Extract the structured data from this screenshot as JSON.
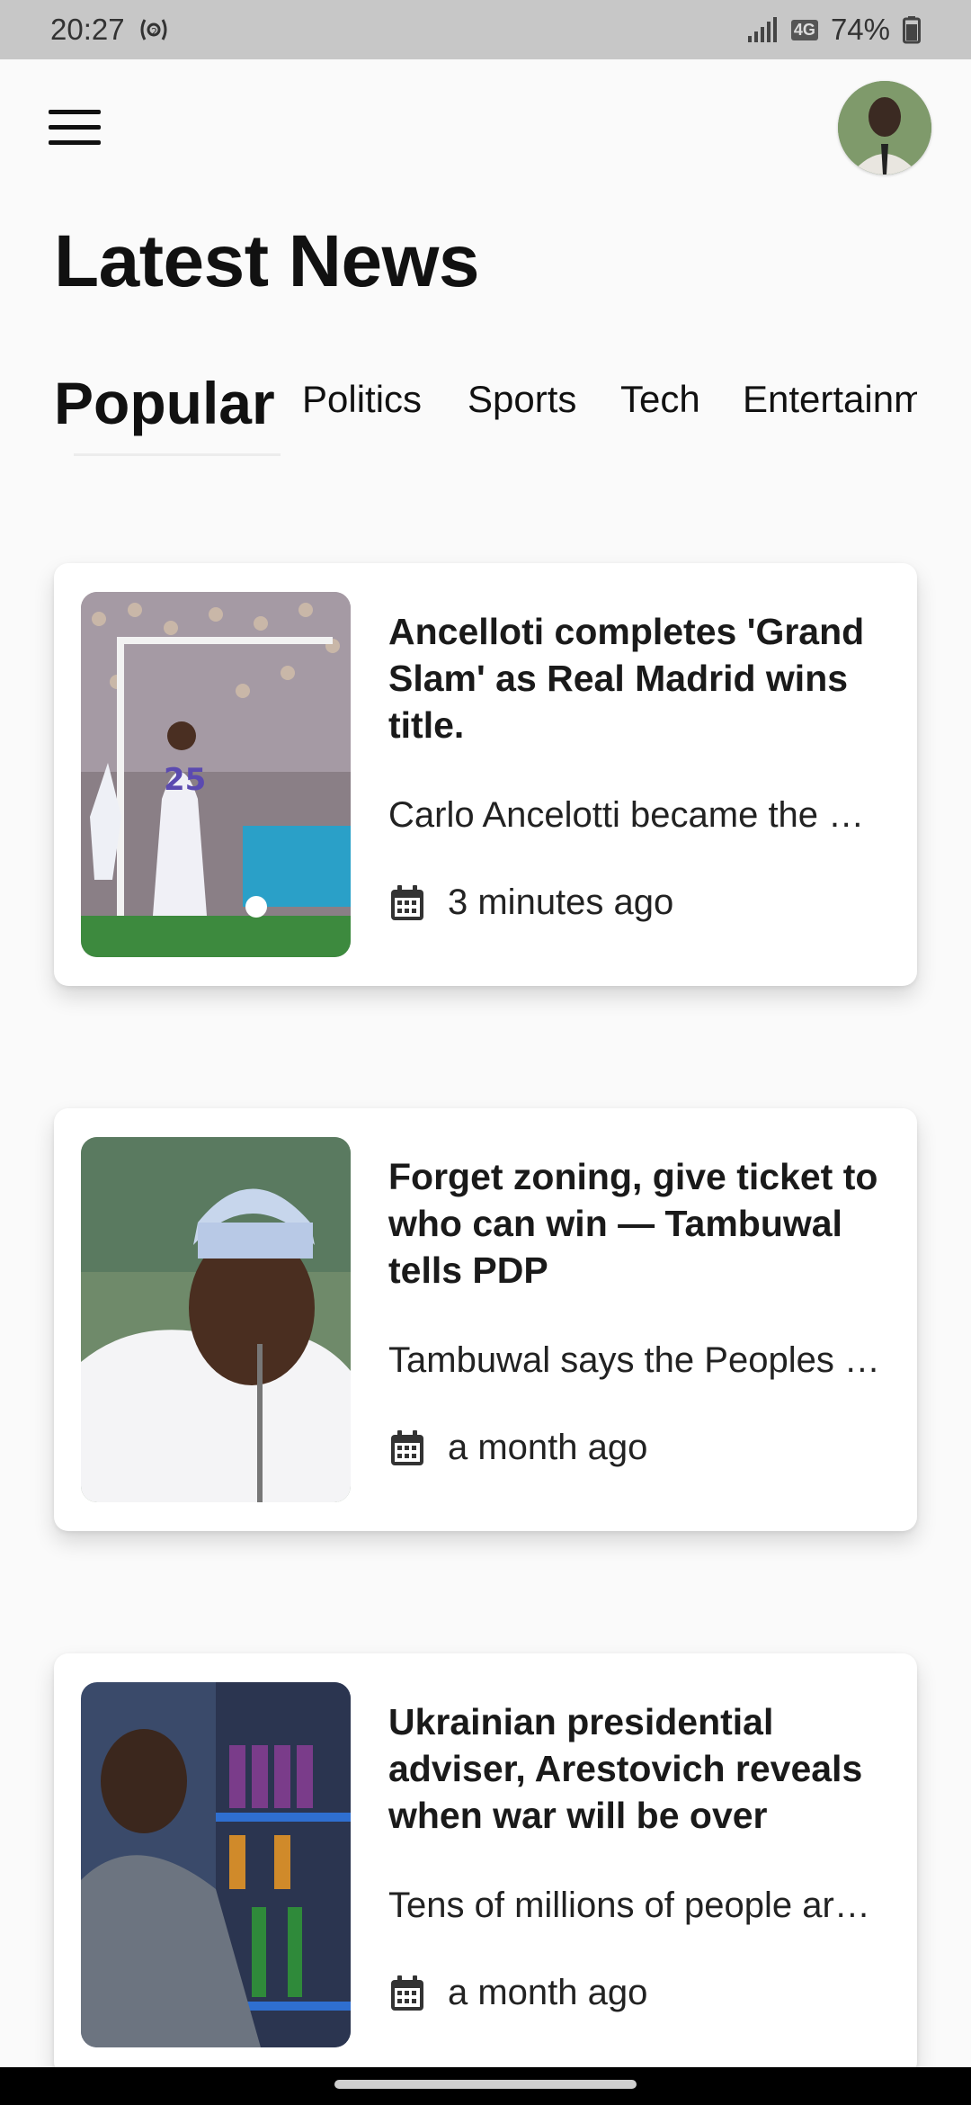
{
  "status_bar": {
    "time": "20:27",
    "network_label": "4G",
    "battery": "74%"
  },
  "header": {
    "menu_icon": "hamburger-menu-icon",
    "avatar": "user-avatar"
  },
  "page_title": "Latest News",
  "tabs": [
    {
      "label": "Popular",
      "active": true
    },
    {
      "label": "Politics",
      "active": false
    },
    {
      "label": "Sports",
      "active": false
    },
    {
      "label": "Tech",
      "active": false
    },
    {
      "label": "Entertainm",
      "active": false
    }
  ],
  "articles": [
    {
      "title": "Ancelloti completes 'Grand Slam' as Real Madrid wins title.",
      "summary": "Carlo Ancelotti became the …",
      "time": "3 minutes ago",
      "image": "football-match-photo"
    },
    {
      "title": "Forget zoning, give ticket to who can win — Tambuwal tells PDP",
      "summary": "Tambuwal says the Peoples …",
      "time": "a month ago",
      "image": "politician-portrait-photo"
    },
    {
      "title": "Ukrainian presidential adviser, Arestovich reveals when war will be over",
      "summary": "Tens of millions of people ar…",
      "time": "a month ago",
      "image": "supermarket-shelf-photo"
    }
  ],
  "icons": {
    "date": "calendar-icon"
  }
}
